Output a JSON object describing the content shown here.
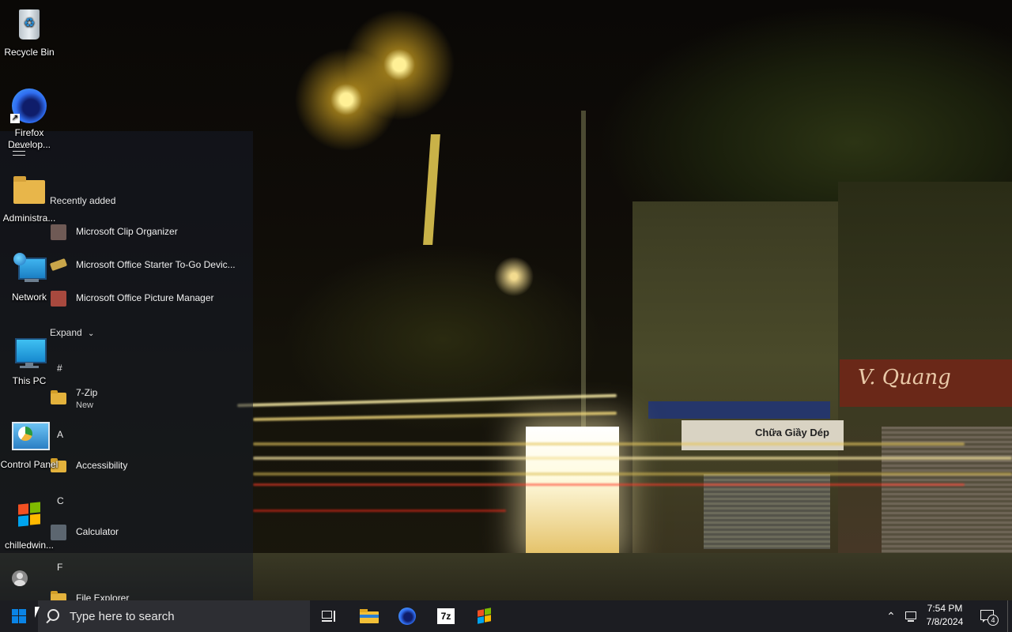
{
  "desktop": {
    "icons": [
      {
        "label": "Recycle Bin",
        "icon": "recycle-bin-icon"
      },
      {
        "label": "Firefox Develop...",
        "icon": "firefox-developer-icon"
      },
      {
        "label": "Administra...",
        "icon": "folder-icon"
      },
      {
        "label": "Network",
        "icon": "network-icon"
      },
      {
        "label": "This PC",
        "icon": "this-pc-icon"
      },
      {
        "label": "Control Panel",
        "icon": "control-panel-icon"
      },
      {
        "label": "chilledwin...",
        "icon": "windows-logo-icon"
      }
    ]
  },
  "wallpaper": {
    "sign_text": "V. Quang",
    "banner_text": "Chữa Giầy Dép"
  },
  "start_menu": {
    "recently_added_label": "Recently added",
    "recent": [
      {
        "label": "Microsoft Clip Organizer"
      },
      {
        "label": "Microsoft Office Starter To-Go Devic..."
      },
      {
        "label": "Microsoft Office Picture Manager"
      }
    ],
    "expand_label": "Expand",
    "sections": [
      {
        "letter": "#",
        "items": [
          {
            "label": "7-Zip",
            "sub": "New"
          }
        ]
      },
      {
        "letter": "A",
        "items": [
          {
            "label": "Accessibility"
          }
        ]
      },
      {
        "letter": "C",
        "items": [
          {
            "label": "Calculator"
          }
        ]
      },
      {
        "letter": "F",
        "items": [
          {
            "label": "File Explorer"
          }
        ]
      }
    ]
  },
  "taskbar": {
    "search_placeholder": "Type here to search",
    "pinned": [
      "task-view-icon",
      "file-explorer-icon",
      "firefox-icon",
      "7zip-icon",
      "windows-flag-icon"
    ],
    "clock_time": "7:54 PM",
    "clock_date": "7/8/2024",
    "notification_count": "4",
    "zip_label": "7z"
  },
  "colors": {
    "taskbar_bg": "#1c1d22",
    "search_bg": "#2d2e33",
    "folder": "#e3b23c",
    "start_accent": "#0a84e6"
  }
}
